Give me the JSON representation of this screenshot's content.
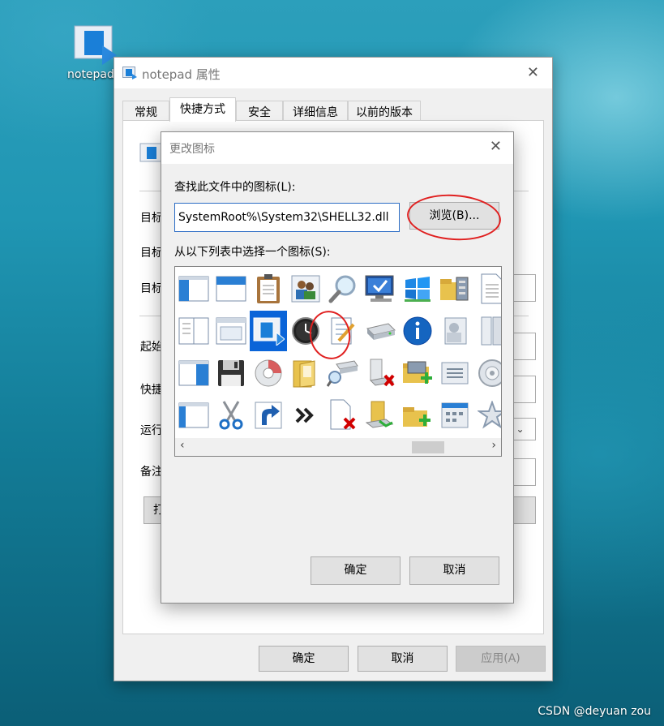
{
  "desktop": {
    "icon_label": "notepad",
    "watermark": "CSDN @deyuan zou"
  },
  "properties": {
    "title": "notepad 属性",
    "tabs": [
      "常规",
      "快捷方式",
      "安全",
      "详细信息",
      "以前的版本"
    ],
    "active_tab": "快捷方式",
    "partial_labels": [
      "目标",
      "目标",
      "目标",
      "起始",
      "快捷",
      "运行",
      "备注"
    ],
    "partial_button": "打",
    "buttons": {
      "ok": "确定",
      "cancel": "取消",
      "apply": "应用(A)"
    }
  },
  "change_icon_dialog": {
    "title": "更改图标",
    "file_label": "查找此文件中的图标(L):",
    "file_value": "SystemRoot%\\System32\\SHELL32.dll",
    "browse_label": "浏览(B)...",
    "list_label": "从以下列表中选择一个图标(S):",
    "ok_label": "确定",
    "cancel_label": "取消",
    "selected_icon": "notepad-icon",
    "icons": [
      "window-sidebar-icon",
      "window-header-icon",
      "clipboard-icon",
      "users-icon",
      "magnifier-icon",
      "monitor-check-icon",
      "windows-logo-icon",
      "folder-cabinet-icon",
      "document-icon",
      "split-window-icon",
      "window-frame-icon",
      "app-shortcut-icon",
      "clock-icon",
      "notepad-icon",
      "drive-icon",
      "info-icon",
      "user-frame-icon",
      "book-icon",
      "window-sidebar-icon",
      "floppy-disk-icon",
      "cd-drive-icon",
      "open-folder-icon",
      "network-drive-icon",
      "drive-remove-icon",
      "folder-add-icon",
      "list-icon",
      "disc-icon",
      "window-panel-icon",
      "scissors-icon",
      "shortcut-arrow-icon",
      "double-chevron-icon",
      "document-remove-icon",
      "folder-link-icon",
      "folder-add-icon",
      "calendar-window-icon",
      "star-icon"
    ]
  },
  "colors": {
    "accent": "#0a64d8",
    "annotation": "#e02020",
    "dialog_bg": "#f0f0f0"
  }
}
